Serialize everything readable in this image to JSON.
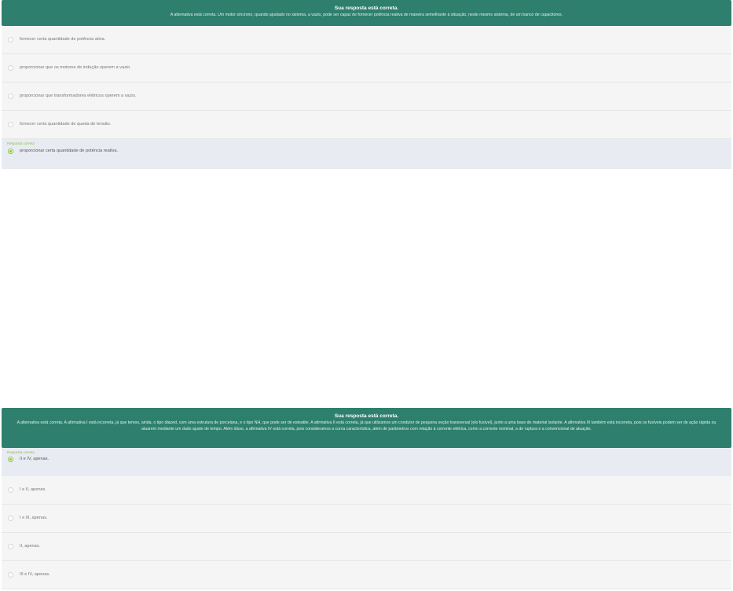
{
  "question1": {
    "feedback_title": "Sua resposta está correta.",
    "feedback_text": "A alternativa está correta. Um motor síncrono, quando ajustado no sistema, a vazio, pode ser capaz de fornecer potência reativa de maneira semelhante à situação, neste mesmo sistema, de um banco de capacitores.",
    "correct_tag": "Resposta correta",
    "options": [
      {
        "label": "fornecer certa quantidade de potência ativa.",
        "selected": false
      },
      {
        "label": "proporcionar que os motores de indução operem a vazio.",
        "selected": false
      },
      {
        "label": "proporcionar que transformadores elétricos operem a vazio.",
        "selected": false
      },
      {
        "label": "fornecer certa quantidade de queda de tensão.",
        "selected": false
      },
      {
        "label": "proporcionar certa quantidade de potência reativa.",
        "selected": true
      }
    ]
  },
  "question2": {
    "feedback_title": "Sua resposta está correta.",
    "feedback_text": "A alternativa está correta. A afirmativa I está incorreta, já que temos, ainda, o tipo diazed, com uma estrutura de porcelana, e o tipo NH, que pode ser de esteatite. A afirmativa II está correta, já que utilizamos um condutor de pequena seção transversal (elo fusível), junto a uma base de material isolante. A afirmativa III também está incorreta, pois os fusíveis podem ser de ação rápida ou atuarem mediante um dado ajuste de tempo. Além disso, a afirmativa IV está correta, pois consideramos a curva característica, além de parâmetros com relação à corrente elétrica, como a corrente nominal, a de ruptura e a convencional de atuação.",
    "correct_tag": "Resposta correta",
    "options": [
      {
        "label": "II e IV, apenas.",
        "selected": true
      },
      {
        "label": "I e II, apenas.",
        "selected": false
      },
      {
        "label": "I e III, apenas.",
        "selected": false
      },
      {
        "label": "II, apenas.",
        "selected": false
      },
      {
        "label": "III e IV, apenas.",
        "selected": false
      }
    ]
  },
  "colors": {
    "banner": "#2e7f6e",
    "correct_accent": "#8cc04a",
    "correct_row": "#e8ecf2",
    "option_row": "#f5f5f5"
  }
}
